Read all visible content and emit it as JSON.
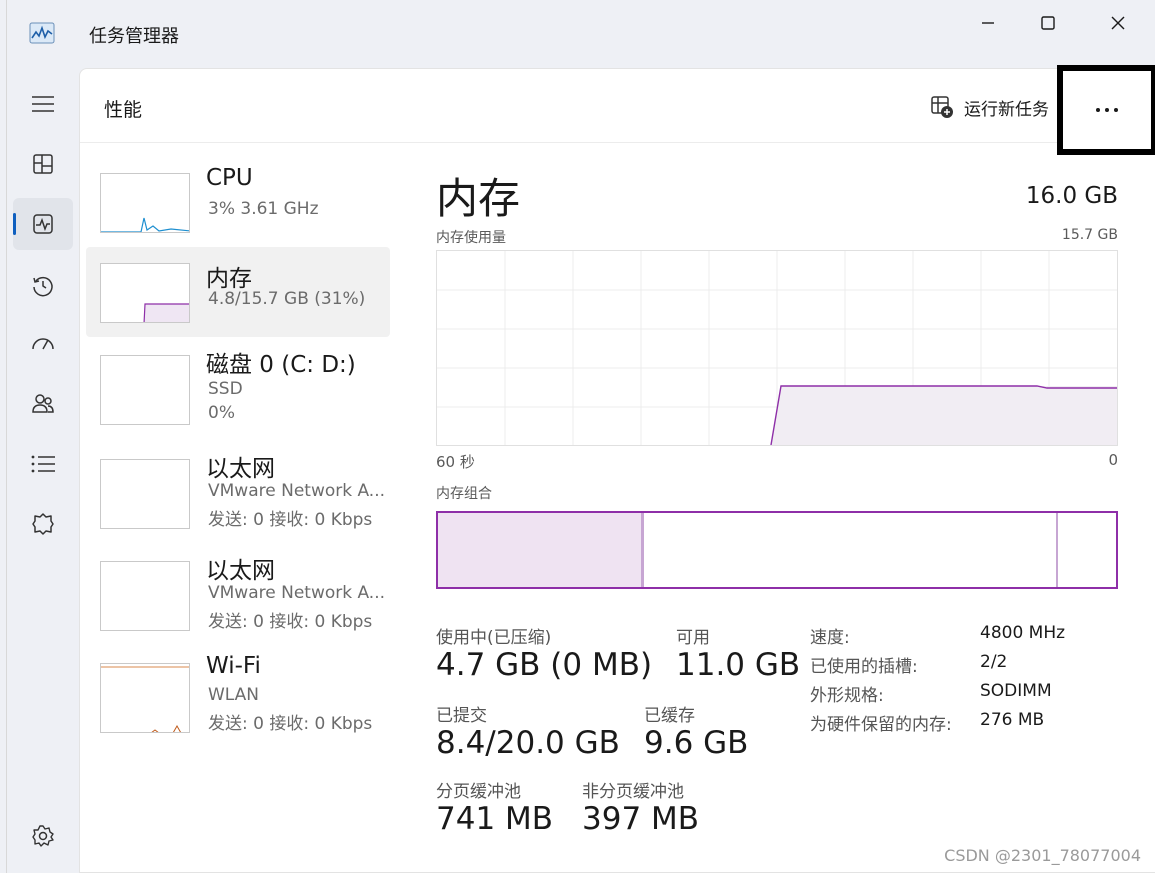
{
  "window": {
    "title": "任务管理器",
    "accent": "#0f5fbf",
    "memory_color": "#8e2fa8"
  },
  "sidebar": {
    "items": [
      {
        "icon": "hamburger-menu-icon"
      },
      {
        "icon": "processes-icon"
      },
      {
        "icon": "performance-icon",
        "active": true
      },
      {
        "icon": "app-history-icon"
      },
      {
        "icon": "startup-apps-icon"
      },
      {
        "icon": "users-icon"
      },
      {
        "icon": "details-icon"
      },
      {
        "icon": "services-icon"
      },
      {
        "icon": "settings-icon"
      }
    ]
  },
  "header": {
    "title": "性能",
    "run_task_label": "运行新任务"
  },
  "perf_list": [
    {
      "name": "CPU",
      "line1": "3%  3.61 GHz",
      "line2": ""
    },
    {
      "name": "内存",
      "line1": "4.8/15.7 GB (31%)",
      "line2": "",
      "selected": true
    },
    {
      "name": "磁盘 0 (C: D:)",
      "line1": "SSD",
      "line2": "0%"
    },
    {
      "name": "以太网",
      "line1": "VMware Network A...",
      "line2": "发送: 0 接收: 0 Kbps"
    },
    {
      "name": "以太网",
      "line1": "VMware Network A...",
      "line2": "发送: 0 接收: 0 Kbps"
    },
    {
      "name": "Wi-Fi",
      "line1": "WLAN",
      "line2": "发送: 0 接收: 0 Kbps"
    }
  ],
  "memory": {
    "title": "内存",
    "total": "16.0 GB",
    "usage_label": "内存使用量",
    "usage_max": "15.7 GB",
    "axis_left": "60 秒",
    "axis_right": "0",
    "composition_label": "内存组合",
    "usage_fraction": 0.31,
    "stats": {
      "in_use_label": "使用中(已压缩)",
      "in_use_value": "4.7 GB (0 MB)",
      "available_label": "可用",
      "available_value": "11.0 GB",
      "committed_label": "已提交",
      "committed_value": "8.4/20.0 GB",
      "cached_label": "已缓存",
      "cached_value": "9.6 GB",
      "paged_label": "分页缓冲池",
      "paged_value": "741 MB",
      "nonpaged_label": "非分页缓冲池",
      "nonpaged_value": "397 MB"
    },
    "specs": [
      {
        "label": "速度:",
        "value": "4800 MHz"
      },
      {
        "label": "已使用的插槽:",
        "value": "2/2"
      },
      {
        "label": "外形规格:",
        "value": "SODIMM"
      },
      {
        "label": "为硬件保留的内存:",
        "value": "276 MB"
      }
    ]
  },
  "watermark": "CSDN @2301_78077004"
}
